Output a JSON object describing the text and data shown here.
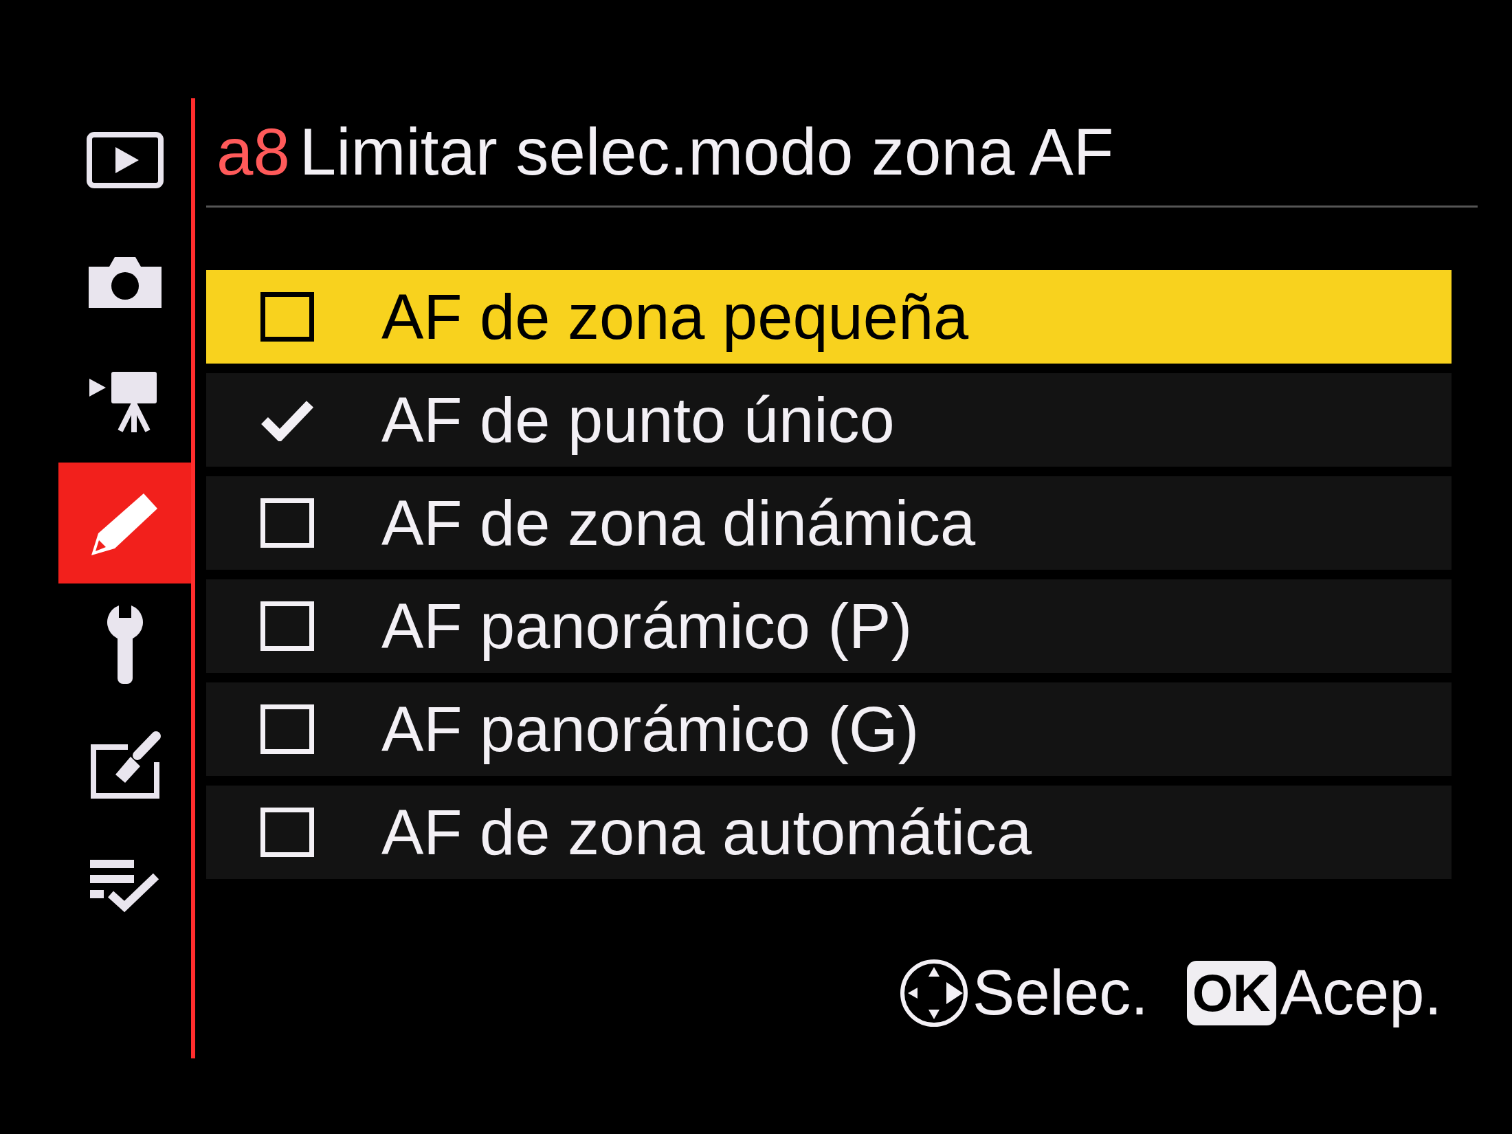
{
  "sidebar": {
    "tabs": [
      {
        "kind": "playback",
        "selected": false
      },
      {
        "kind": "photo",
        "selected": false
      },
      {
        "kind": "movie",
        "selected": false
      },
      {
        "kind": "custom",
        "selected": true
      },
      {
        "kind": "setup",
        "selected": false
      },
      {
        "kind": "retouch",
        "selected": false
      },
      {
        "kind": "mymenu",
        "selected": false
      }
    ]
  },
  "title": {
    "code": "a8",
    "text": "Limitar selec.modo zona AF"
  },
  "options": [
    {
      "label": "AF de zona pequeña",
      "checked": false,
      "selected": true
    },
    {
      "label": "AF de punto único",
      "checked": true,
      "selected": false
    },
    {
      "label": "AF de zona dinámica",
      "checked": false,
      "selected": false
    },
    {
      "label": "AF panorámico (P)",
      "checked": false,
      "selected": false
    },
    {
      "label": "AF panorámico (G)",
      "checked": false,
      "selected": false
    },
    {
      "label": "AF de zona automática",
      "checked": false,
      "selected": false
    }
  ],
  "footer": {
    "hints": [
      {
        "kind": "dpad",
        "label": "Selec."
      },
      {
        "kind": "key",
        "key": "OK",
        "label": "Acep."
      }
    ]
  }
}
